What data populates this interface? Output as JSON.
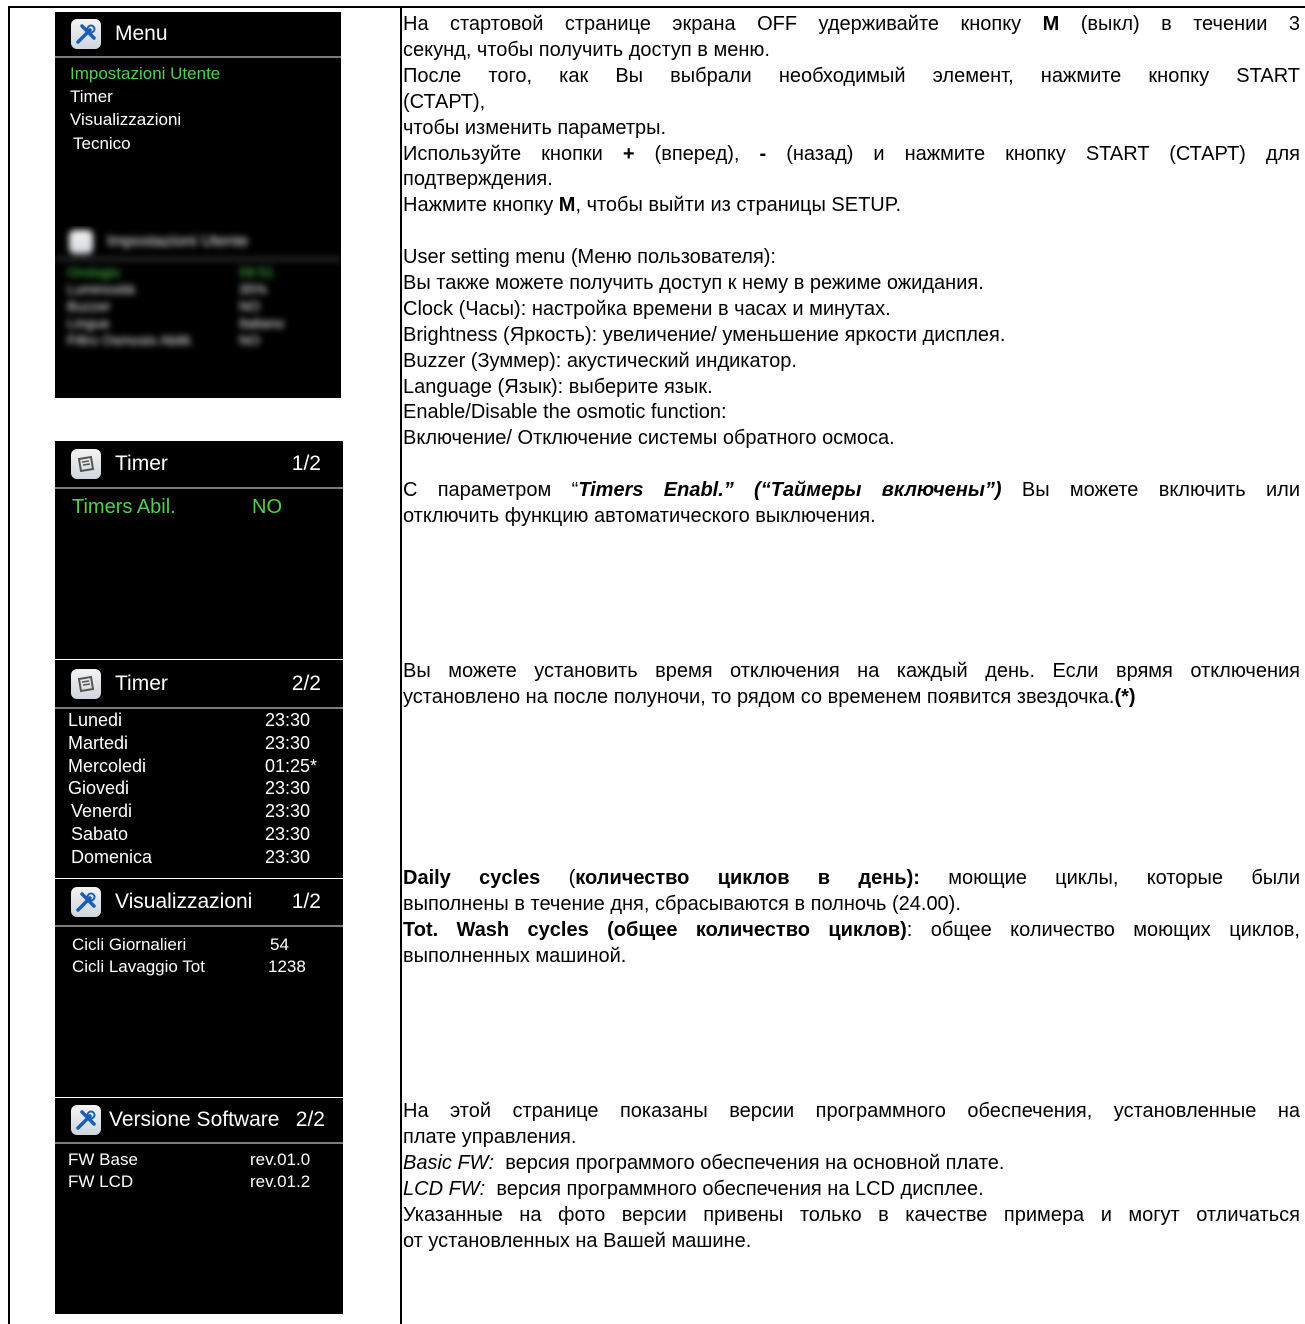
{
  "screens": {
    "menu": {
      "title": "Menu",
      "items": [
        "Impostazioni Utente",
        "Timer",
        "Visualizzazioni",
        "Tecnico"
      ]
    },
    "user_settings": {
      "title": "Impostazioni Utente",
      "rows": [
        {
          "label": "Orologio",
          "value": "09:51"
        },
        {
          "label": "Luminosità",
          "value": "35%"
        },
        {
          "label": "Buzzer",
          "value": "NO"
        },
        {
          "label": "Lingua",
          "value": "Italiano"
        },
        {
          "label": "Filtro Osmosis Abilit.",
          "value": "NO"
        }
      ]
    },
    "timer1": {
      "title": "Timer",
      "page": "1/2",
      "label": "Timers Abil.",
      "value": "NO"
    },
    "timer2": {
      "title": "Timer",
      "page": "2/2",
      "rows": [
        {
          "day": "Lunedi",
          "time": "23:30"
        },
        {
          "day": "Martedi",
          "time": "23:30"
        },
        {
          "day": "Mercoledi",
          "time": "01:25*"
        },
        {
          "day": "Giovedi",
          "time": "23:30"
        },
        {
          "day": "Venerdi",
          "time": "23:30"
        },
        {
          "day": "Sabato",
          "time": "23:30"
        },
        {
          "day": "Domenica",
          "time": "23:30"
        }
      ]
    },
    "visual": {
      "title": "Visualizzazioni",
      "page": "1/2",
      "rows": [
        {
          "label": "Cicli Giornalieri",
          "value": "54"
        },
        {
          "label": "Cicli Lavaggio Tot",
          "value": "1238"
        }
      ]
    },
    "software": {
      "title": "Versione Software",
      "page": "2/2",
      "rows": [
        {
          "label": "FW Base",
          "value": "rev.01.0"
        },
        {
          "label": "FW LCD",
          "value": "rev.01.2"
        }
      ]
    }
  },
  "text": {
    "s1": {
      "l1": "На стартовой странице экрана OFF удерживайте кнопку",
      "l1_m": "M",
      "l1_end": "(выкл) в течении 3",
      "l2": "секунд, чтобы получить доступ в меню.",
      "l3": "После того, как Вы выбрали необходимый элемент, нажмите кнопку START",
      "l4": "(СТАРТ),",
      "l5": "чтобы изменить параметры.",
      "l6_a": "Используйте кнопки",
      "l6_plus": "+",
      "l6_b": "(вперед),",
      "l6_minus": "-",
      "l6_c": "(назад) и нажмите кнопку START (СТАРТ) для",
      "l7": "подтверждения.",
      "l8_a": "Нажмите кнопку",
      "l8_m": "M",
      "l8_b": ", чтобы выйти из страницы SETUP."
    },
    "s2": {
      "l1": "User setting menu (Меню пользователя):",
      "l2": "Вы также можете получить доступ к нему в режиме ожидания.",
      "l3": "Clock (Часы): настройка времени в часах и минутах.",
      "l4": "Brightness (Яркость): увеличение/ уменьшение яркости дисплея.",
      "l5": "Buzzer (Зуммер): акустический индикатор.",
      "l6": "Language (Язык): выберите язык.",
      "l7": "Enable/Disable the osmotic function:",
      "l8": "Включение/ Отключение системы обратного осмоса."
    },
    "s3": {
      "l1_a": "С параметром “",
      "l1_b": "Timers Enabl.” (“Таймеры включены”)",
      "l1_c": " Вы можете включить или",
      "l2": "отключить функцию автоматического выключения."
    },
    "s4": {
      "l1": "Вы можете установить время отключения  на каждый день. Если врямя отключения",
      "l2_a": "установлено на после полуночи, то рядом со временем появится звездочка.",
      "l2_b": "(*)"
    },
    "s5": {
      "l1_a": "Daily cycles",
      "l1_b": " (",
      "l1_c": "количество циклов в день):",
      "l1_d": " моющие циклы, которые были",
      "l2": "выполнены в течение дня, сбрасываются в полночь (24.00).",
      "l3_a": "Tot. Wash cycles (общее количество циклов)",
      "l3_b": ": общее количество моющих циклов,",
      "l4": "выполненных машиной."
    },
    "s6": {
      "l1": "На этой странице показаны версии программного обеспечения, установленные на",
      "l2": "плате управления.",
      "l3_a": "Basic FW:",
      "l3_b": "  версия программого обеспечения на основной плате.",
      "l4_a": "LCD FW:",
      "l4_b": "  версия программного обеспечения на LCD дисплее.",
      "l5": "Указанные на фото версии привены только в качестве примера и могут отличаться",
      "l6": "от установленных на Вашей машине."
    }
  },
  "colors": {
    "screen_bg": "#000000",
    "highlight": "#4fd14f",
    "text": "#ffffff"
  }
}
